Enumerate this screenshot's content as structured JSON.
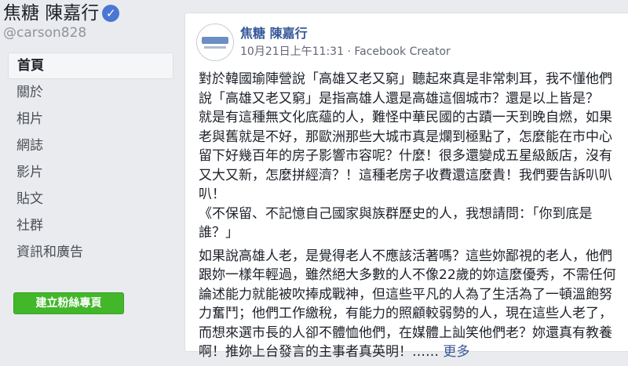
{
  "page": {
    "name": "焦糖 陳嘉行",
    "verified_icon": "verified-check-icon",
    "handle": "@carson828"
  },
  "nav": {
    "items": [
      {
        "label": "首頁",
        "active": true
      },
      {
        "label": "關於",
        "active": false
      },
      {
        "label": "相片",
        "active": false
      },
      {
        "label": "網誌",
        "active": false
      },
      {
        "label": "影片",
        "active": false
      },
      {
        "label": "貼文",
        "active": false
      },
      {
        "label": "社群",
        "active": false
      },
      {
        "label": "資訊和廣告",
        "active": false
      }
    ],
    "create_button": "建立粉絲專頁"
  },
  "post": {
    "author": "焦糖 陳嘉行",
    "date": "10月21日上午11:31",
    "separator": "·",
    "source": "Facebook Creator",
    "globe_icon": "globe-icon",
    "paragraphs": [
      "對於韓國瑜陣營說「高雄又老又窮」聽起來真是非常刺耳，我不懂他們\n說「高雄又老又窮」是指高雄人還是高雄這個城市？還是以上皆是？\n就是有這種無文化底蘊的人，難怪中華民國的古蹟一天到晚自燃，如果\n老與舊就是不好，那歐洲那些大城市真是爛到極點了，怎麼能在市中心\n留下好幾百年的房子影響市容呢？什麼！很多還變成五星級飯店，沒有\n又大又新，怎麼拼經濟？！這種老房子收費還這麼貴！我們要告訴叭叭\n叭！\n《不保留、不記憶自己國家與族群歷史的人，我想請問：「你到底是\n誰？」",
      "如果說高雄人老，是覺得老人不應該活著嗎？這些妳鄙視的老人，他們\n跟妳一樣年輕過，雖然絕大多數的人不像22歲的妳這麼優秀，不需任何\n論述能力就能被吹捧成戰神，但這些平凡的人為了生活為了一頓溫飽努\n力奮鬥；他們工作繳稅，有能力的照顧較弱勢的人，現在這些人老了，\n而想來選市長的人卻不體恤他們，在媒體上訕笑他們老？妳還真有教養\n啊！推妳上台發言的主事者真英明！……"
    ],
    "see_more": "更多"
  }
}
